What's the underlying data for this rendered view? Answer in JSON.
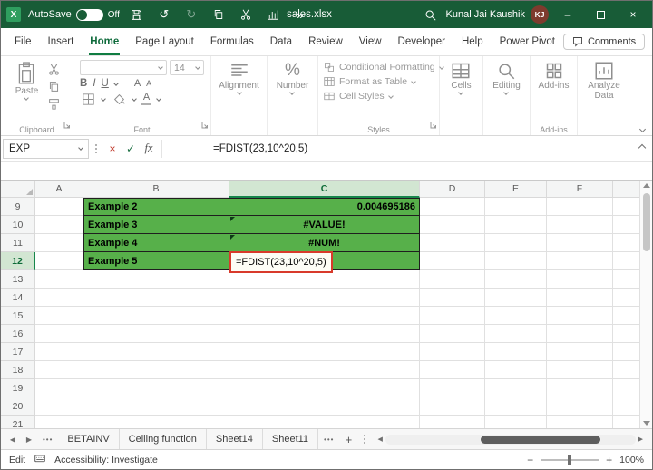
{
  "titlebar": {
    "autosave_label": "AutoSave",
    "autosave_state": "Off",
    "filename": "sales.xlsx",
    "user_name": "Kunal Jai Kaushik",
    "user_initials": "KJ"
  },
  "tabs": {
    "items": [
      "File",
      "Insert",
      "Home",
      "Page Layout",
      "Formulas",
      "Data",
      "Review",
      "View",
      "Developer",
      "Help",
      "Power Pivot"
    ],
    "active": "Home",
    "comments_label": "Comments"
  },
  "ribbon": {
    "paste_label": "Paste",
    "clipboard_group_label": "Clipboard",
    "font_size_value": "14",
    "bold_label": "B",
    "italic_label": "I",
    "underline_label": "U",
    "font_color_label": "A",
    "grow_font_label": "A",
    "shrink_font_label": "A",
    "font_group_label": "Font",
    "alignment_label": "Alignment",
    "number_label": "Number",
    "percent_glyph": "%",
    "conditional_formatting_label": "Conditional Formatting",
    "format_as_table_label": "Format as Table",
    "cell_styles_label": "Cell Styles",
    "styles_group_label": "Styles",
    "cells_label": "Cells",
    "editing_label": "Editing",
    "addins_label": "Add-ins",
    "addins_group_label": "Add-ins",
    "analyze_data_label": "Analyze Data"
  },
  "formula_bar": {
    "name_box_value": "EXP",
    "fx_label": "fx",
    "formula": "=FDIST(23,10^20,5)"
  },
  "grid": {
    "column_letters": [
      "A",
      "B",
      "C",
      "D",
      "E",
      "F"
    ],
    "row_numbers": [
      "9",
      "10",
      "11",
      "12",
      "13",
      "14",
      "15",
      "16",
      "17",
      "18",
      "19",
      "20",
      "21"
    ],
    "selected_column": "C",
    "selected_row": "12",
    "highlight_color": "#57B04A",
    "cells": {
      "r9": {
        "B": "Example 2",
        "C": "0.004695186"
      },
      "r10": {
        "B": "Example 3",
        "C": "#VALUE!"
      },
      "r11": {
        "B": "Example 4",
        "C": "#NUM!"
      },
      "r12": {
        "B": "Example 5",
        "C": "=FDIST(23,10^20,5)"
      }
    }
  },
  "sheet_bar": {
    "tabs": [
      "BETAINV",
      "Ceiling function",
      "Sheet14",
      "Sheet11"
    ],
    "overflow_label": "•••",
    "new_sheet_label": "+"
  },
  "status_bar": {
    "mode": "Edit",
    "accessibility": "Accessibility: Investigate",
    "zoom": "100%"
  },
  "colors": {
    "titlebar_green": "#185C37",
    "accent_green": "#107C41",
    "cell_green": "#57B04A",
    "annotation_red": "#D83A2B"
  }
}
